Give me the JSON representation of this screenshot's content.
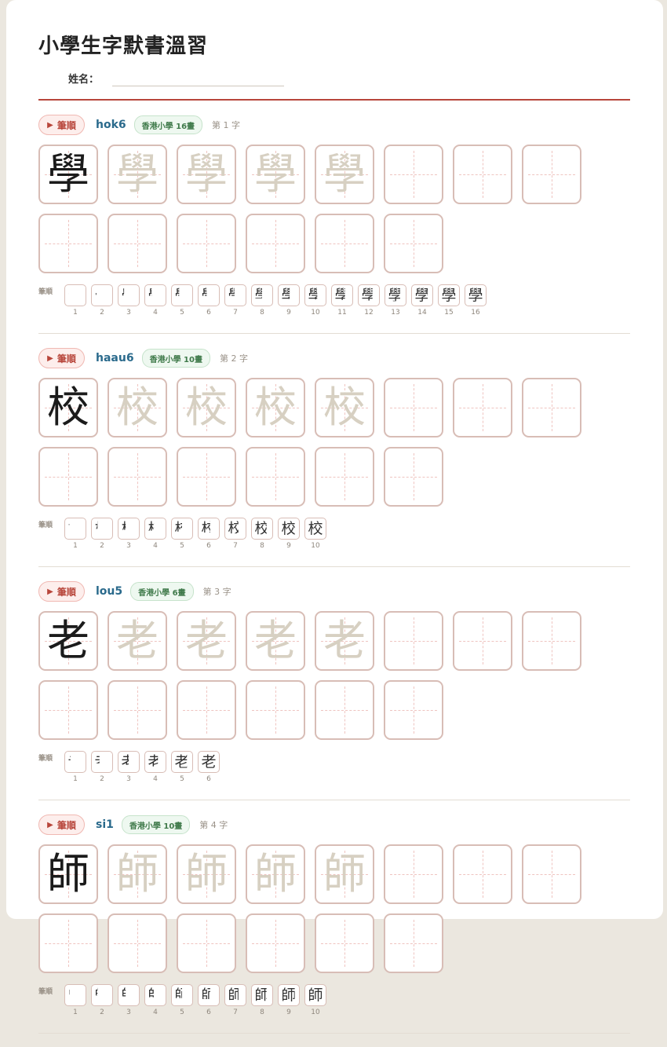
{
  "page": {
    "title": "小學生字默書溫習",
    "name_label": "姓名："
  },
  "sections": [
    {
      "character": "學",
      "jyutping": "hok6",
      "badge": "香港小學 16畫",
      "order": "第 1 字",
      "stroke_button": "筆順",
      "strokes_label": "筆順",
      "stroke_count": 16,
      "stroke_numbers": [
        "1",
        "2",
        "3",
        "4",
        "5",
        "6",
        "7",
        "8",
        "9",
        "10",
        "11",
        "12",
        "13",
        "14",
        "15",
        "16"
      ]
    },
    {
      "character": "校",
      "jyutping": "haau6",
      "badge": "香港小學 10畫",
      "order": "第 2 字",
      "stroke_button": "筆順",
      "strokes_label": "筆順",
      "stroke_count": 10,
      "stroke_numbers": [
        "1",
        "2",
        "3",
        "4",
        "5",
        "6",
        "7",
        "8",
        "9",
        "10"
      ]
    },
    {
      "character": "老",
      "jyutping": "lou5",
      "badge": "香港小學 6畫",
      "order": "第 3 字",
      "stroke_button": "筆順",
      "strokes_label": "筆順",
      "stroke_count": 6,
      "stroke_numbers": [
        "1",
        "2",
        "3",
        "4",
        "5",
        "6"
      ]
    },
    {
      "character": "師",
      "jyutping": "si1",
      "badge": "香港小學 10畫",
      "order": "第 4 字",
      "stroke_button": "筆順",
      "strokes_label": "筆順",
      "stroke_count": 10,
      "stroke_numbers": [
        "1",
        "2",
        "3",
        "4",
        "5",
        "6",
        "7",
        "8",
        "9",
        "10"
      ]
    }
  ],
  "grid": {
    "model_cells": 1,
    "trace_cells": 4,
    "blank_cells": 9
  },
  "colors": {
    "accent": "#b8463b",
    "jyutping": "#2a6a8c",
    "badge": "#3f7a4a",
    "trace": "#d7d0c2"
  },
  "icons": {
    "stroke_button": "play-icon"
  }
}
